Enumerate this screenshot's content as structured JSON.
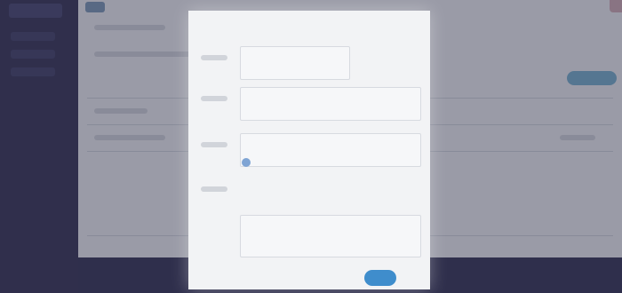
{
  "screen": {
    "note": ""
  },
  "colors": {
    "sidebar_bg": "#27264a",
    "main_bg": "#e8eaee",
    "overlay": "rgba(60,60,80,0.45)",
    "modal_bg": "#f2f3f5",
    "primary": "#3f8dcc",
    "accent": "#6aa6c7"
  },
  "modal": {
    "title": "",
    "ok_label": "",
    "fields": [
      {
        "label": "",
        "value": "",
        "placeholder": ""
      },
      {
        "label": "",
        "value": "",
        "placeholder": ""
      },
      {
        "label": "",
        "value": "",
        "placeholder": ""
      },
      {
        "label": "",
        "value": "",
        "placeholder": ""
      }
    ],
    "notes_placeholder": ""
  }
}
